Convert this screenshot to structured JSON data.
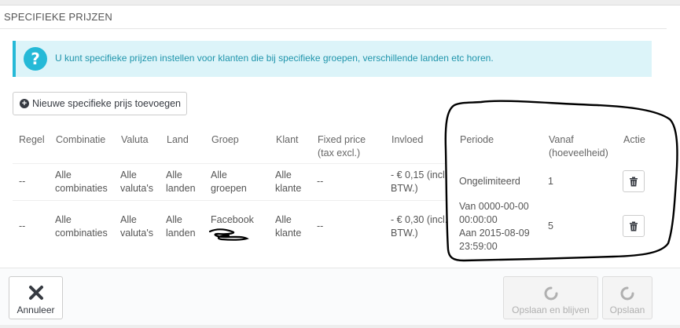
{
  "panel": {
    "title": "SPECIFIEKE PRIJZEN"
  },
  "alert": {
    "icon": "question-icon",
    "icon_glyph": "?",
    "text": "U kunt specifieke prijzen instellen voor klanten die bij specifieke groepen, verschillende landen etc horen."
  },
  "add_button": {
    "icon": "plus-circle-icon",
    "label": "Nieuwe specifieke prijs toevoegen"
  },
  "table": {
    "headers": {
      "regel": "Regel",
      "combinatie": "Combinatie",
      "valuta": "Valuta",
      "land": "Land",
      "groep": "Groep",
      "klant": "Klant",
      "fixed_price": [
        "Fixed price",
        "(tax excl.)"
      ],
      "invloed": "Invloed",
      "periode": "Periode",
      "vanaf": [
        "Vanaf",
        "(hoeveelheid)"
      ],
      "actie": "Actie"
    },
    "rows": [
      {
        "regel": "--",
        "combinatie": [
          "Alle",
          "combinaties"
        ],
        "valuta": [
          "Alle",
          "valuta's"
        ],
        "land": [
          "Alle",
          "landen"
        ],
        "groep": [
          "Alle",
          "groepen"
        ],
        "klant": [
          "Alle",
          "klante"
        ],
        "fixed_price": "--",
        "invloed": [
          "- € 0,15 (incl.",
          "BTW.)"
        ],
        "periode": [
          "Ongelimiteerd"
        ],
        "vanaf": "1",
        "actie": "trash-icon"
      },
      {
        "regel": "--",
        "combinatie": [
          "Alle",
          "combinaties"
        ],
        "valuta": [
          "Alle",
          "valuta's"
        ],
        "land": [
          "Alle",
          "landen"
        ],
        "groep": [
          "Facebook"
        ],
        "klant": [
          "Alle",
          "klante"
        ],
        "fixed_price": "--",
        "invloed": [
          "- € 0,30 (incl.",
          "BTW.)"
        ],
        "periode": [
          "Van 0000-00-00",
          "00:00:00",
          "Aan 2015-08-09",
          "23:59:00"
        ],
        "vanaf": "5",
        "actie": "trash-icon"
      }
    ]
  },
  "footer": {
    "cancel": {
      "icon": "close-icon",
      "label": "Annuleer"
    },
    "save_stay": {
      "icon": "refresh-icon",
      "label": "Opslaan en blijven"
    },
    "save": {
      "icon": "refresh-icon",
      "label": "Opslaan"
    }
  },
  "colors": {
    "alert_bg": "#dcf4f9",
    "alert_accent": "#25b9d7",
    "alert_text": "#1e94ab",
    "annotation_ink": "#000000"
  }
}
